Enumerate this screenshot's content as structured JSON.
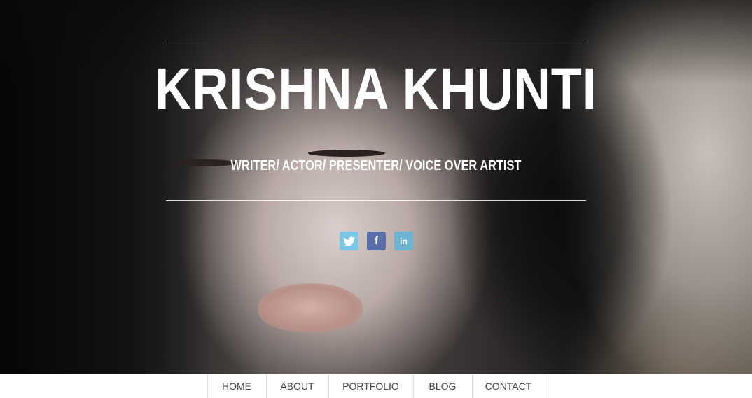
{
  "hero": {
    "title": "KRISHNA KHUNTI",
    "subtitle": "WRITER/ ACTOR/ PRESENTER/ VOICE OVER ARTIST"
  },
  "social": [
    {
      "icon": "twitter-icon",
      "glyph": "",
      "color": "#7cc6e8"
    },
    {
      "icon": "facebook-icon",
      "glyph": "f",
      "color": "#5a6fa8"
    },
    {
      "icon": "linkedin-icon",
      "glyph": "in",
      "color": "#6fb3d2"
    }
  ],
  "nav": {
    "items": [
      {
        "label": "HOME"
      },
      {
        "label": "ABOUT"
      },
      {
        "label": "PORTFOLIO"
      },
      {
        "label": "BLOG"
      },
      {
        "label": "CONTACT"
      }
    ]
  }
}
